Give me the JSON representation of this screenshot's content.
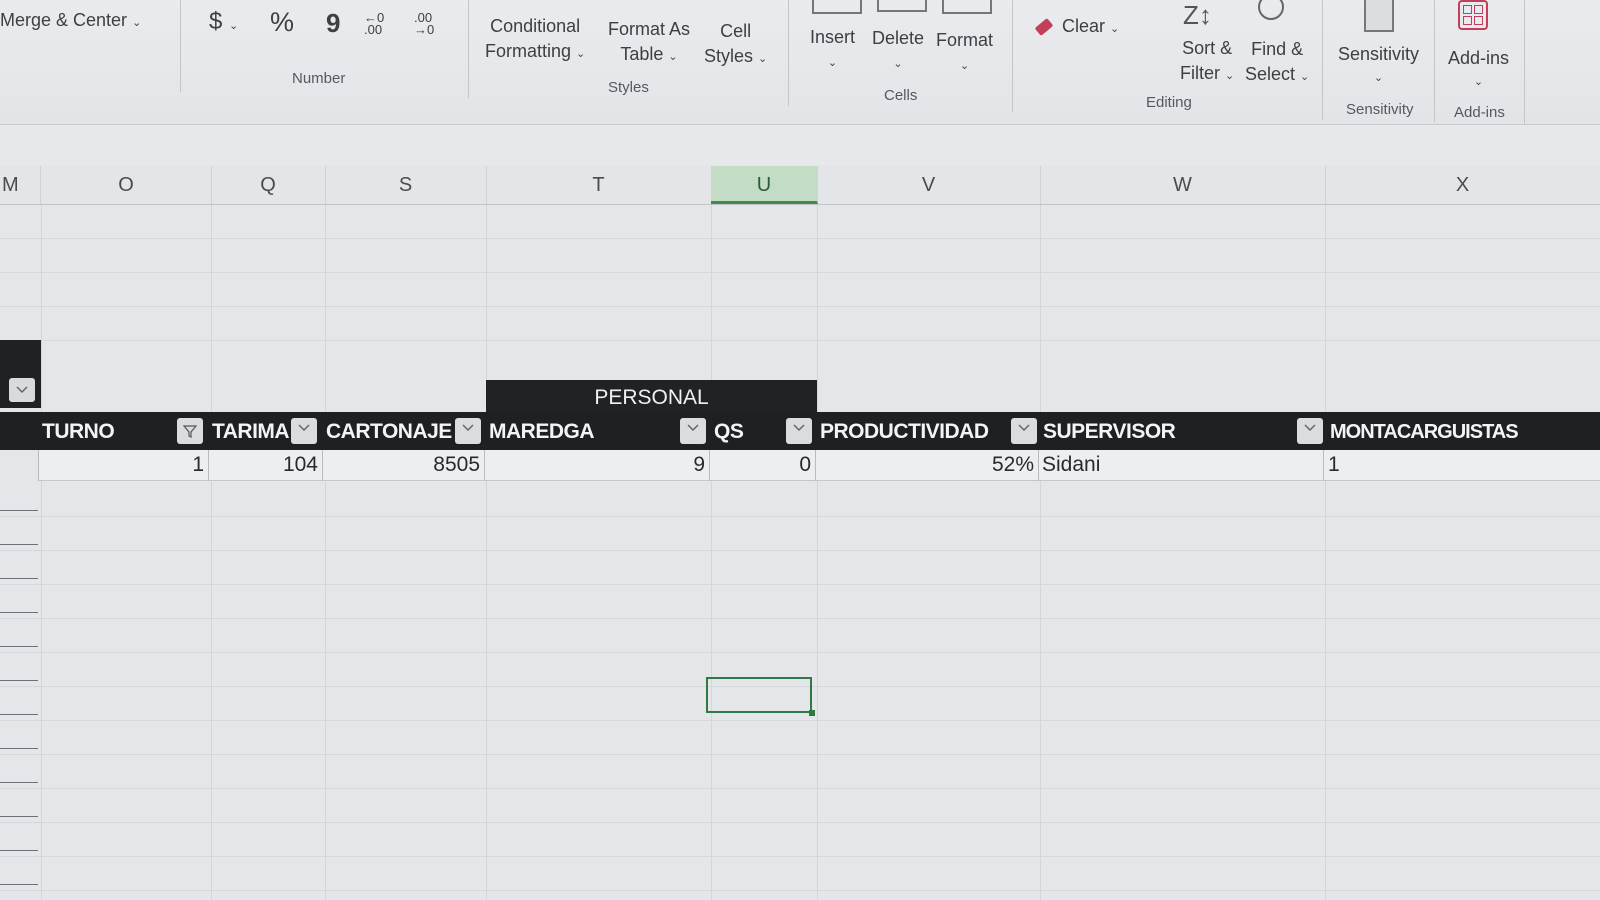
{
  "ribbon": {
    "alignment": {
      "merge_center": "Merge & Center"
    },
    "number": {
      "currency": "$",
      "percent": "%",
      "comma": "9",
      "inc_decimal": "←0 .00",
      "dec_decimal": ".00 →0",
      "title": "Number"
    },
    "styles": {
      "conditional_formatting": [
        "Conditional",
        "Formatting"
      ],
      "format_as_table": [
        "Format As",
        "Table"
      ],
      "cell_styles": [
        "Cell",
        "Styles"
      ],
      "title": "Styles"
    },
    "cells": {
      "insert": "Insert",
      "delete": "Delete",
      "format": "Format",
      "title": "Cells"
    },
    "editing": {
      "clear": "Clear",
      "sort_filter": [
        "Sort &",
        "Filter"
      ],
      "find_select": [
        "Find &",
        "Select"
      ],
      "title": "Editing"
    },
    "sensitivity": {
      "label": "Sensitivity",
      "title": "Sensitivity"
    },
    "addins": {
      "label": "Add-ins",
      "title": "Add-ins"
    }
  },
  "columns": [
    "M",
    "O",
    "Q",
    "S",
    "T",
    "U",
    "V",
    "W",
    "X"
  ],
  "selected_column": "U",
  "table": {
    "group_header": "PERSONAL",
    "headers": [
      "TURNO",
      "TARIMA",
      "CARTONAJE",
      "MAREDGA",
      "QS",
      "PRODUCTIVIDAD",
      "SUPERVISOR",
      "MONTACARGUISTAS"
    ],
    "row": [
      "1",
      "104",
      "8505",
      "9",
      "0",
      "52%",
      "Sidani",
      "1"
    ]
  },
  "colors": {
    "header_bg": "#1e2024",
    "header_text": "#f4f4f4",
    "selected_accent": "#2f7a43"
  }
}
